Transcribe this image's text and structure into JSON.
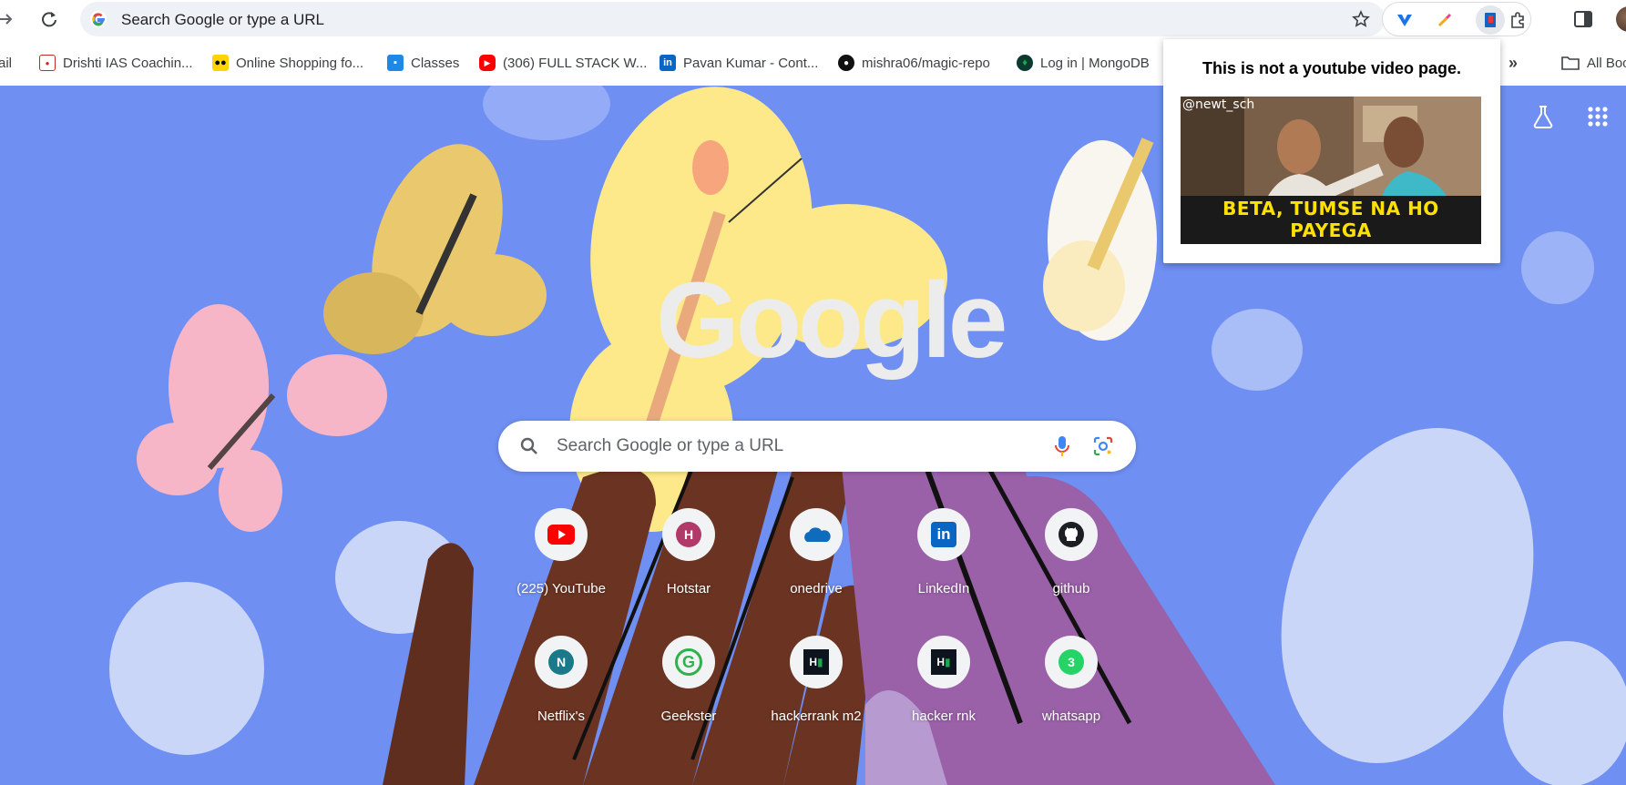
{
  "toolbar": {
    "omnibox_placeholder": "Search Google or type a URL"
  },
  "bookmarks": [
    {
      "label": "ail",
      "icon": "gmail-icon"
    },
    {
      "label": "Drishti IAS Coachin...",
      "icon": "drishti-icon"
    },
    {
      "label": "Online Shopping fo...",
      "icon": "shopping-icon"
    },
    {
      "label": "Classes",
      "icon": "classroom-icon"
    },
    {
      "label": "(306) FULL STACK W...",
      "icon": "youtube-icon"
    },
    {
      "label": "Pavan Kumar - Cont...",
      "icon": "linkedin-icon"
    },
    {
      "label": "mishra06/magic-repo",
      "icon": "github-icon"
    },
    {
      "label": "Log in | MongoDB",
      "icon": "mongodb-icon"
    }
  ],
  "bookmarks_overflow": "»",
  "all_bookmarks_label": "All Boo",
  "ntp": {
    "logo_text": "Google",
    "search_placeholder": "Search Google or type a URL",
    "shortcuts_row1": [
      {
        "label": "(225) YouTube",
        "icon": "youtube-icon"
      },
      {
        "label": "Hotstar",
        "icon": "hotstar-icon"
      },
      {
        "label": "onedrive",
        "icon": "onedrive-icon"
      },
      {
        "label": "LinkedIn",
        "icon": "linkedin-icon"
      },
      {
        "label": "github",
        "icon": "github-icon"
      }
    ],
    "shortcuts_row2": [
      {
        "label": "Netflix's",
        "icon": "netflix-icon"
      },
      {
        "label": "Geekster",
        "icon": "geekster-icon"
      },
      {
        "label": "hackerrank m2",
        "icon": "hackerrank-icon"
      },
      {
        "label": "hacker rnk",
        "icon": "hackerrank-icon"
      },
      {
        "label": "whatsapp",
        "icon": "whatsapp-icon"
      }
    ]
  },
  "popup": {
    "title": "This is not a youtube video page.",
    "meme_handle": "@newt_sch",
    "meme_caption": "BETA, TUMSE NA HO PAYEGA"
  },
  "colors": {
    "background": "#6f8ff2",
    "omnibox": "#eef1f6",
    "meme_caption": "#ffe100"
  }
}
